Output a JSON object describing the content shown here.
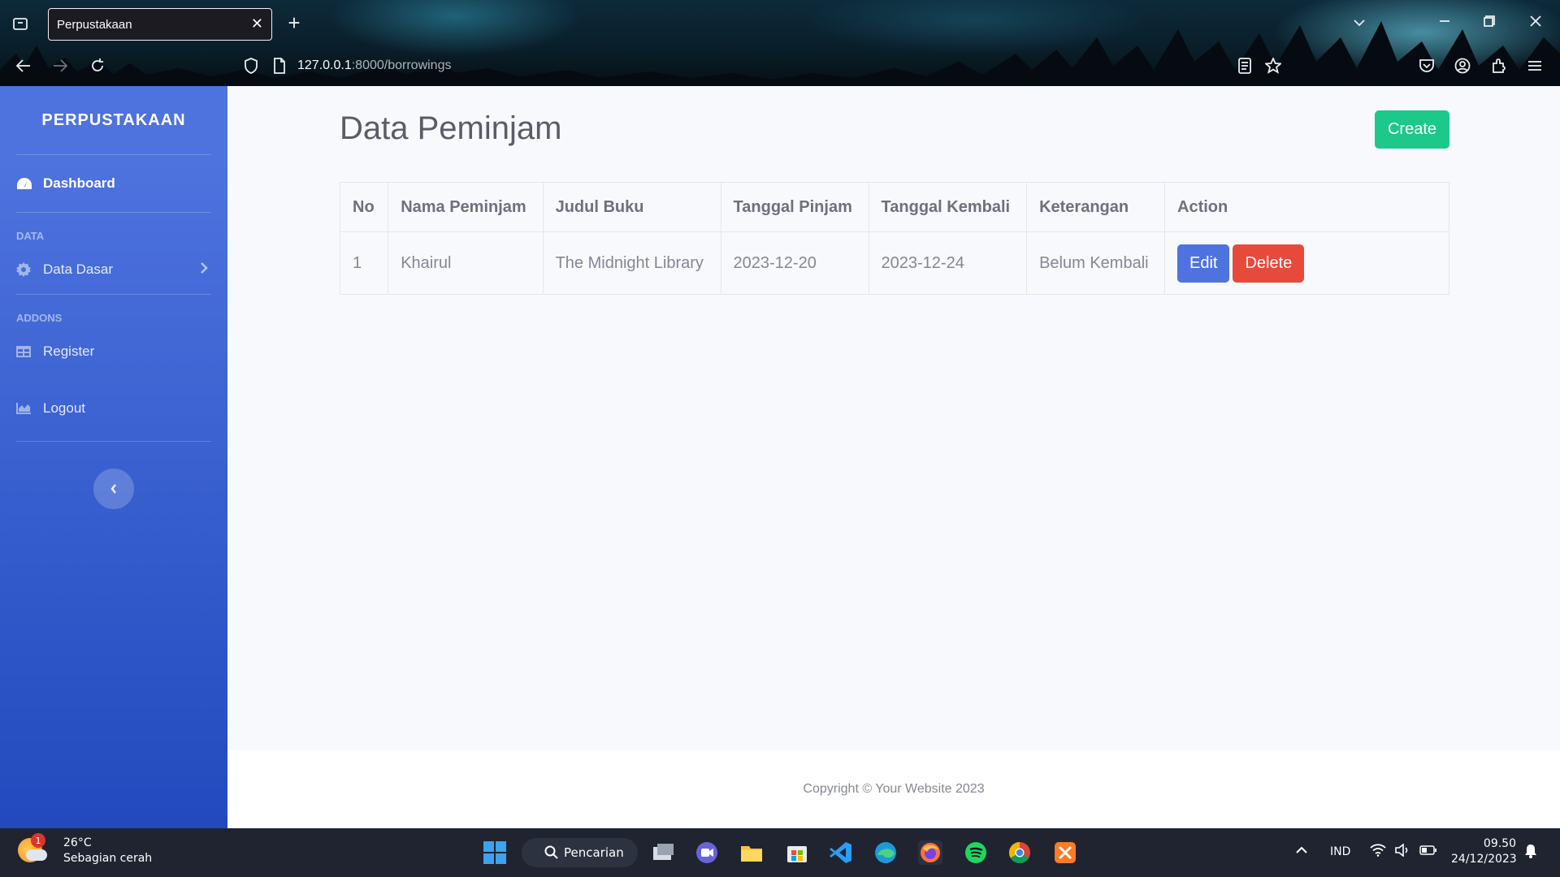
{
  "browser": {
    "tab_title": "Perpustakaan",
    "url_host": "127.0.0.1",
    "url_path": ":8000/borrowings"
  },
  "sidebar": {
    "brand": "PERPUSTAKAAN",
    "dashboard": "Dashboard",
    "heading_data": "DATA",
    "data_dasar": "Data Dasar",
    "heading_addons": "ADDONS",
    "register": "Register",
    "logout": "Logout"
  },
  "main": {
    "title": "Data Peminjam",
    "create_label": "Create",
    "table": {
      "headers": [
        "No",
        "Nama Peminjam",
        "Judul Buku",
        "Tanggal Pinjam",
        "Tanggal Kembali",
        "Keterangan",
        "Action"
      ],
      "rows": [
        {
          "no": "1",
          "nama": "Khairul",
          "judul": "The Midnight Library",
          "tgl_pinjam": "2023-12-20",
          "tgl_kembali": "2023-12-24",
          "keterangan": "Belum Kembali",
          "edit_label": "Edit",
          "delete_label": "Delete"
        }
      ]
    }
  },
  "footer": {
    "copyright": "Copyright © Your Website 2023"
  },
  "taskbar": {
    "weather_temp": "26°C",
    "weather_desc": "Sebagian cerah",
    "weather_badge": "1",
    "search_label": "Pencarian",
    "language": "IND",
    "time": "09.50",
    "date": "24/12/2023"
  },
  "colors": {
    "sidebar_top": "#4e73df",
    "sidebar_bottom": "#224abe",
    "create": "#1cc88a",
    "edit": "#4e73df",
    "delete": "#e74a3b"
  }
}
